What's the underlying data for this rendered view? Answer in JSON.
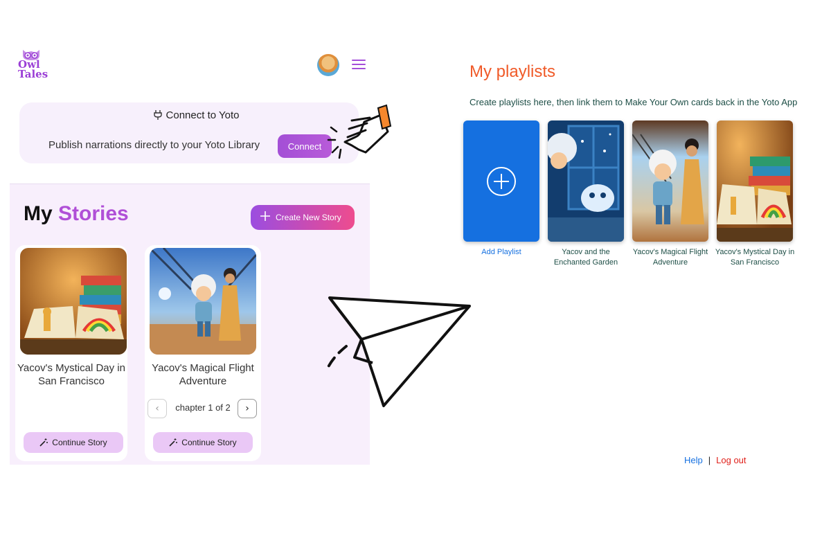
{
  "app": {
    "logo_text": "Owl Tales"
  },
  "connect": {
    "title": "Connect to Yoto",
    "description": "Publish narrations directly to your Yoto Library",
    "button_label": "Connect"
  },
  "stories": {
    "title_word1": "My",
    "title_word2": "Stories",
    "create_label": "Create New Story",
    "items": [
      {
        "title": "Yacov's Mystical Day in San Francisco",
        "continue_label": "Continue Story"
      },
      {
        "title": "Yacov's Magical Flight Adventure",
        "chapter_label": "chapter 1 of 2",
        "continue_label": "Continue Story"
      }
    ]
  },
  "playlists": {
    "title": "My playlists",
    "subtitle": "Create playlists here, then link them to Make Your Own cards back in the Yoto App",
    "add_label": "Add Playlist",
    "items": [
      {
        "title": "Yacov and the Enchanted Garden"
      },
      {
        "title": "Yacov's Magical Flight Adventure"
      },
      {
        "title": "Yacov's Mystical Day in San Francisco"
      }
    ]
  },
  "footer": {
    "help": "Help",
    "separator": "|",
    "logout": "Log out"
  },
  "colors": {
    "brand_purple": "#b04fd7",
    "playlist_orange": "#f05a28",
    "yoto_blue": "#1570e0",
    "logout_red": "#e0201a"
  },
  "icons": [
    "owl-logo-icon",
    "avatar",
    "hamburger-menu-icon",
    "plug-icon",
    "plus-icon",
    "magic-wand-icon",
    "chevron-left-icon",
    "chevron-right-icon",
    "pointing-hand-icon",
    "paper-plane-icon",
    "add-circle-icon"
  ]
}
